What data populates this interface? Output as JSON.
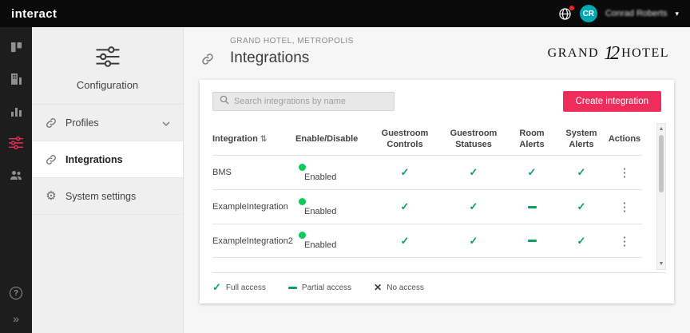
{
  "topbar": {
    "logo": "interact",
    "user": {
      "initials": "CR",
      "name": "Conrad Roberts"
    }
  },
  "icon_rail": {
    "items": [
      {
        "name": "dashboard"
      },
      {
        "name": "building"
      },
      {
        "name": "reports"
      },
      {
        "name": "configuration",
        "active": true
      },
      {
        "name": "users"
      }
    ],
    "help": "?",
    "expand": "»"
  },
  "sidebar": {
    "title": "Configuration",
    "items": [
      {
        "label": "Profiles",
        "expandable": true
      },
      {
        "label": "Integrations",
        "active": true
      },
      {
        "label": "System settings"
      }
    ]
  },
  "header": {
    "breadcrumb": "GRAND HOTEL, METROPOLIS",
    "title": "Integrations",
    "brand": {
      "left": "GRAND",
      "monogram": "12",
      "right": "HOTEL"
    }
  },
  "main": {
    "search_placeholder": "Search integrations by name",
    "create_button": "Create integration",
    "table": {
      "columns": [
        "Integration",
        "Enable/Disable",
        "Guestroom Controls",
        "Guestroom Statuses",
        "Room Alerts",
        "System Alerts",
        "Actions"
      ],
      "rows": [
        {
          "name": "BMS",
          "status": "Enabled",
          "guestroom_controls": "full",
          "guestroom_statuses": "full",
          "room_alerts": "full",
          "system_alerts": "full"
        },
        {
          "name": "ExampleIntegration",
          "status": "Enabled",
          "guestroom_controls": "full",
          "guestroom_statuses": "full",
          "room_alerts": "partial",
          "system_alerts": "full"
        },
        {
          "name": "ExampleIntegration2",
          "status": "Enabled",
          "guestroom_controls": "full",
          "guestroom_statuses": "full",
          "room_alerts": "partial",
          "system_alerts": "full"
        }
      ]
    },
    "legend": [
      {
        "symbol": "check",
        "label": "Full access"
      },
      {
        "symbol": "dash",
        "label": "Partial access"
      },
      {
        "symbol": "cross",
        "label": "No access"
      }
    ]
  },
  "colors": {
    "accent": "#ee2d5d",
    "green": "#0ba15b",
    "dot_green": "#0ccb5c",
    "teal": "#00a7b5"
  }
}
